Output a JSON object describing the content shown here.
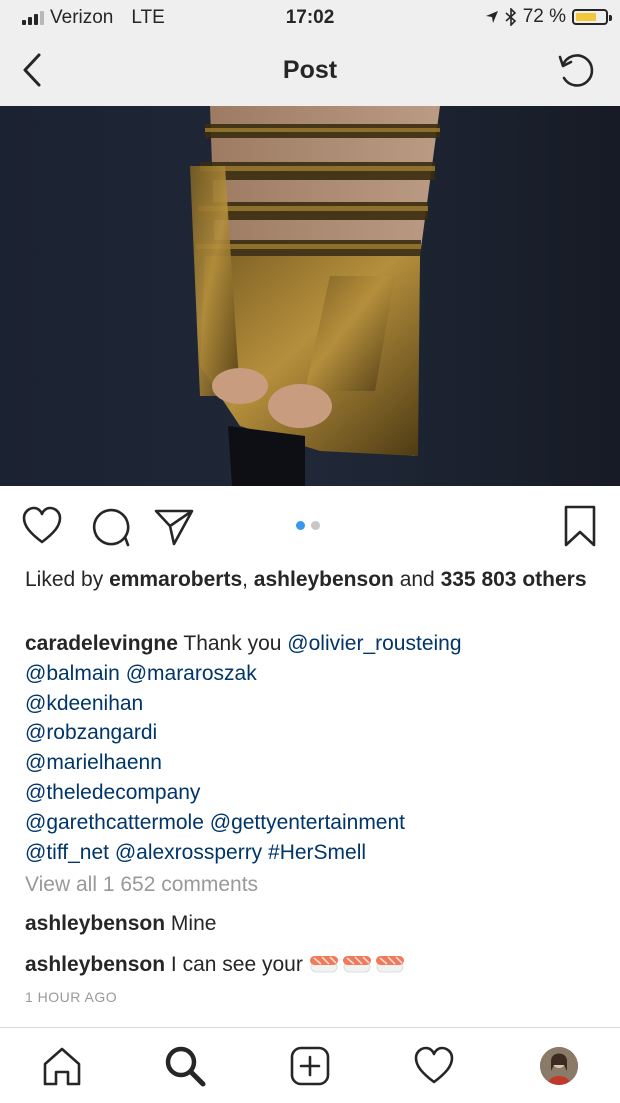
{
  "status_bar": {
    "carrier": "Verizon",
    "network": "LTE",
    "time": "17:02",
    "battery": "72 %",
    "battery_level": 0.72
  },
  "nav": {
    "title": "Post",
    "back_icon": "chevron-left-icon",
    "refresh_icon": "refresh-icon"
  },
  "post": {
    "carousel": {
      "count": 2,
      "active": 1
    },
    "likes": {
      "prefix": "Liked by ",
      "user1": "emmaroberts",
      "sep": ", ",
      "user2": "ashleybenson",
      "and": " and ",
      "count": "335 803",
      "others": "others"
    },
    "caption": {
      "author": "caradelevingne",
      "text": "Thank you",
      "tags": [
        "@olivier_rousteing",
        "@balmain",
        "@mararoszak",
        "@kdeenihan",
        "@robzangardi",
        "@marielhaenn",
        "@theledecompany",
        "@garethcattermole",
        "@gettyentertainment",
        "@tiff_net",
        "@alexrossperry",
        "#HerSmell"
      ]
    },
    "view_all": "View all 1 652 comments",
    "comments": [
      {
        "user": "ashleybenson",
        "text": "Mine"
      },
      {
        "user": "ashleybenson",
        "text": "I can see your",
        "emoji": "sushi"
      }
    ],
    "timestamp": "1 HOUR AGO"
  },
  "colors": {
    "text": "#262626",
    "link": "#003569",
    "muted": "#999999",
    "accent": "#3897f0",
    "bar_bg": "#efefef",
    "battery": "#f4c63a"
  }
}
